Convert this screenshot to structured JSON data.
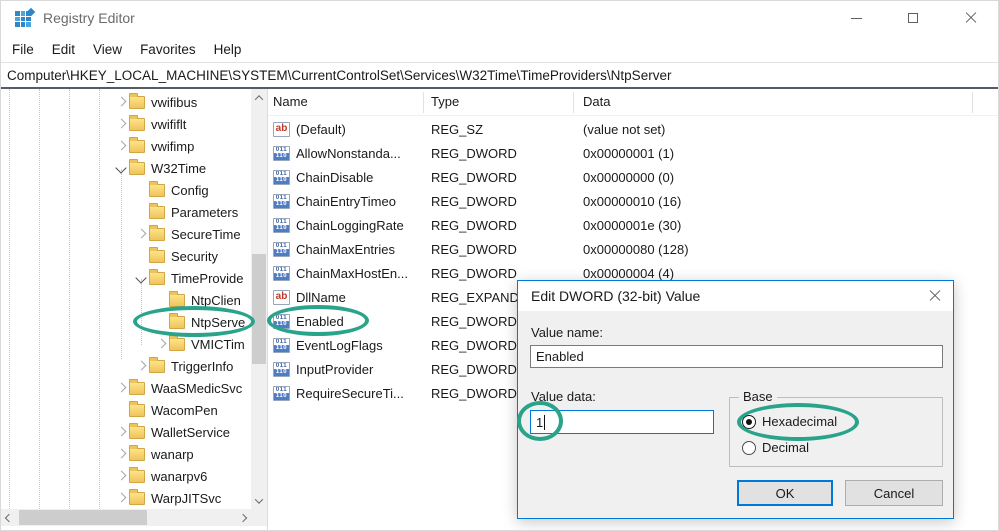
{
  "window": {
    "title": "Registry Editor"
  },
  "menu": {
    "items": [
      "File",
      "Edit",
      "View",
      "Favorites",
      "Help"
    ]
  },
  "address": {
    "path": "Computer\\HKEY_LOCAL_MACHINE\\SYSTEM\\CurrentControlSet\\Services\\W32Time\\TimeProviders\\NtpServer"
  },
  "tree": {
    "items": [
      {
        "label": "vwifibus",
        "level": 1,
        "expander": "collapsed"
      },
      {
        "label": "vwififlt",
        "level": 1,
        "expander": "collapsed"
      },
      {
        "label": "vwifimp",
        "level": 1,
        "expander": "collapsed"
      },
      {
        "label": "W32Time",
        "level": 1,
        "expander": "expanded"
      },
      {
        "label": "Config",
        "level": 2,
        "expander": "none"
      },
      {
        "label": "Parameters",
        "level": 2,
        "expander": "none"
      },
      {
        "label": "SecureTime",
        "level": 2,
        "expander": "collapsed"
      },
      {
        "label": "Security",
        "level": 2,
        "expander": "none"
      },
      {
        "label": "TimeProvide",
        "level": 2,
        "expander": "expanded"
      },
      {
        "label": "NtpClien",
        "level": 3,
        "expander": "none"
      },
      {
        "label": "NtpServe",
        "level": 3,
        "expander": "none",
        "annotated": true
      },
      {
        "label": "VMICTim",
        "level": 3,
        "expander": "collapsed"
      },
      {
        "label": "TriggerInfo",
        "level": 2,
        "expander": "collapsed"
      },
      {
        "label": "WaaSMedicSvc",
        "level": 1,
        "expander": "collapsed"
      },
      {
        "label": "WacomPen",
        "level": 1,
        "expander": "none"
      },
      {
        "label": "WalletService",
        "level": 1,
        "expander": "collapsed"
      },
      {
        "label": "wanarp",
        "level": 1,
        "expander": "collapsed"
      },
      {
        "label": "wanarpv6",
        "level": 1,
        "expander": "collapsed"
      },
      {
        "label": "WarpJITSvc",
        "level": 1,
        "expander": "collapsed"
      }
    ]
  },
  "list": {
    "columns": [
      "Name",
      "Type",
      "Data"
    ],
    "rows": [
      {
        "name": "(Default)",
        "type": "REG_SZ",
        "data": "(value not set)",
        "icon": "string"
      },
      {
        "name": "AllowNonstanda...",
        "type": "REG_DWORD",
        "data": "0x00000001 (1)",
        "icon": "dword"
      },
      {
        "name": "ChainDisable",
        "type": "REG_DWORD",
        "data": "0x00000000 (0)",
        "icon": "dword"
      },
      {
        "name": "ChainEntryTimeo",
        "type": "REG_DWORD",
        "data": "0x00000010 (16)",
        "icon": "dword"
      },
      {
        "name": "ChainLoggingRate",
        "type": "REG_DWORD",
        "data": "0x0000001e (30)",
        "icon": "dword"
      },
      {
        "name": "ChainMaxEntries",
        "type": "REG_DWORD",
        "data": "0x00000080 (128)",
        "icon": "dword"
      },
      {
        "name": "ChainMaxHostEn...",
        "type": "REG_DWORD",
        "data": "0x00000004 (4)",
        "icon": "dword"
      },
      {
        "name": "DllName",
        "type": "REG_EXPAND_SZ",
        "data": "",
        "icon": "string"
      },
      {
        "name": "Enabled",
        "type": "REG_DWORD",
        "data": "",
        "icon": "dword",
        "annotated": true
      },
      {
        "name": "EventLogFlags",
        "type": "REG_DWORD",
        "data": "",
        "icon": "dword"
      },
      {
        "name": "InputProvider",
        "type": "REG_DWORD",
        "data": "",
        "icon": "dword"
      },
      {
        "name": "RequireSecureTi...",
        "type": "REG_DWORD",
        "data": "",
        "icon": "dword"
      }
    ]
  },
  "icons": {
    "string_icon_text": "ab",
    "dword_icon_top": "011",
    "dword_icon_bottom": "110"
  },
  "dialog": {
    "title": "Edit DWORD (32-bit) Value",
    "value_name_label": "Value name:",
    "value_name": "Enabled",
    "value_data_label": "Value data:",
    "value_data": "1",
    "base_label": "Base",
    "base_options": [
      {
        "label": "Hexadecimal",
        "selected": true,
        "annotated": true
      },
      {
        "label": "Decimal",
        "selected": false
      }
    ],
    "ok_label": "OK",
    "cancel_label": "Cancel"
  },
  "annotation_color": "#2aa38b"
}
